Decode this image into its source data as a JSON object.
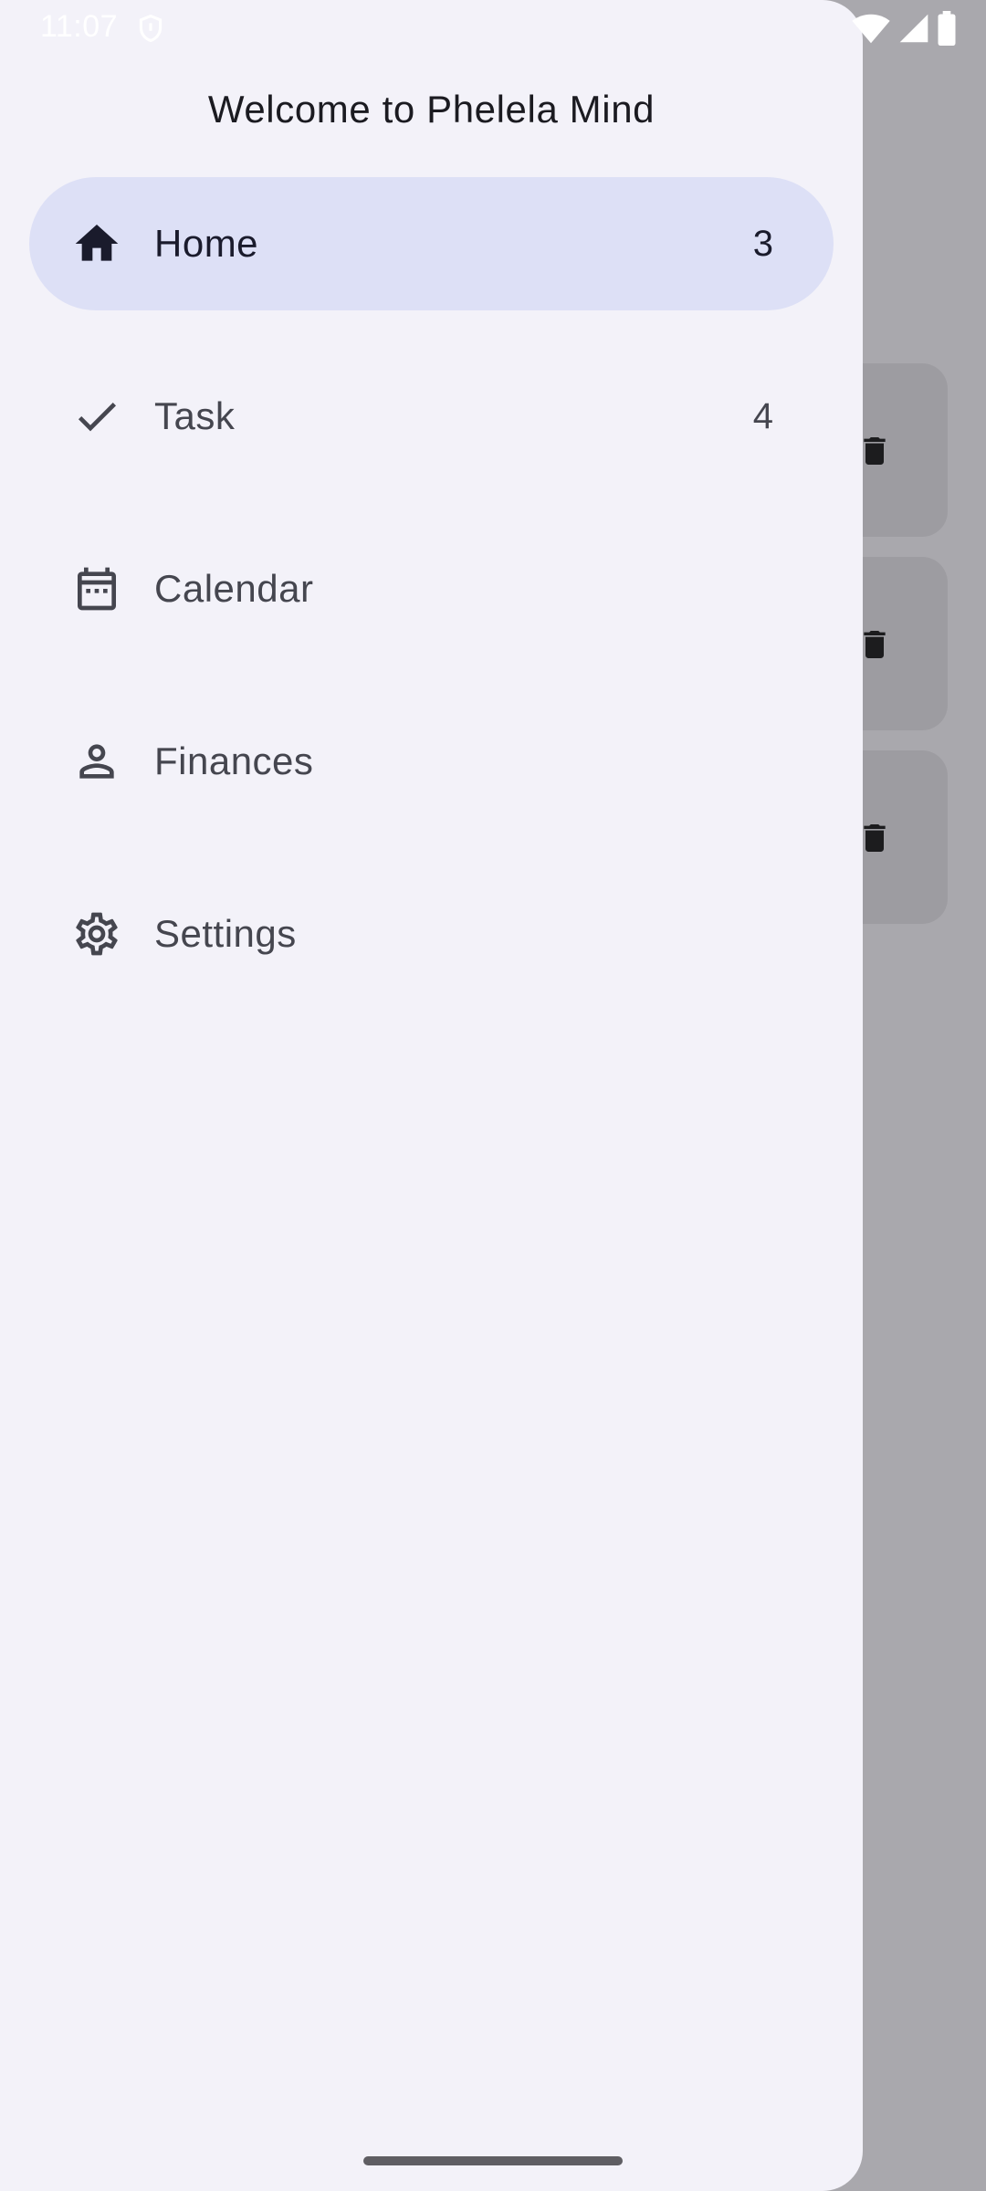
{
  "status_bar": {
    "time": "11:07",
    "icons": [
      "shield-icon",
      "wifi-icon",
      "cell-signal-icon",
      "battery-icon"
    ]
  },
  "drawer": {
    "title": "Welcome to Phelela Mind",
    "items": [
      {
        "label": "Home",
        "badge": "3",
        "icon": "home-icon",
        "active": true
      },
      {
        "label": "Task",
        "badge": "4",
        "icon": "check-icon",
        "active": false
      },
      {
        "label": "Calendar",
        "badge": "",
        "icon": "calendar-icon",
        "active": false
      },
      {
        "label": "Finances",
        "badge": "",
        "icon": "person-icon",
        "active": false
      },
      {
        "label": "Settings",
        "badge": "",
        "icon": "gear-icon",
        "active": false
      }
    ]
  },
  "background": {
    "cards": [
      {
        "icon": "trash-icon"
      },
      {
        "icon": "trash-icon"
      },
      {
        "icon": "trash-icon"
      }
    ]
  },
  "colors": {
    "drawer_bg": "#f3f2f9",
    "active_bg": "#dde0f6",
    "scrim": "#a9a8ad"
  }
}
